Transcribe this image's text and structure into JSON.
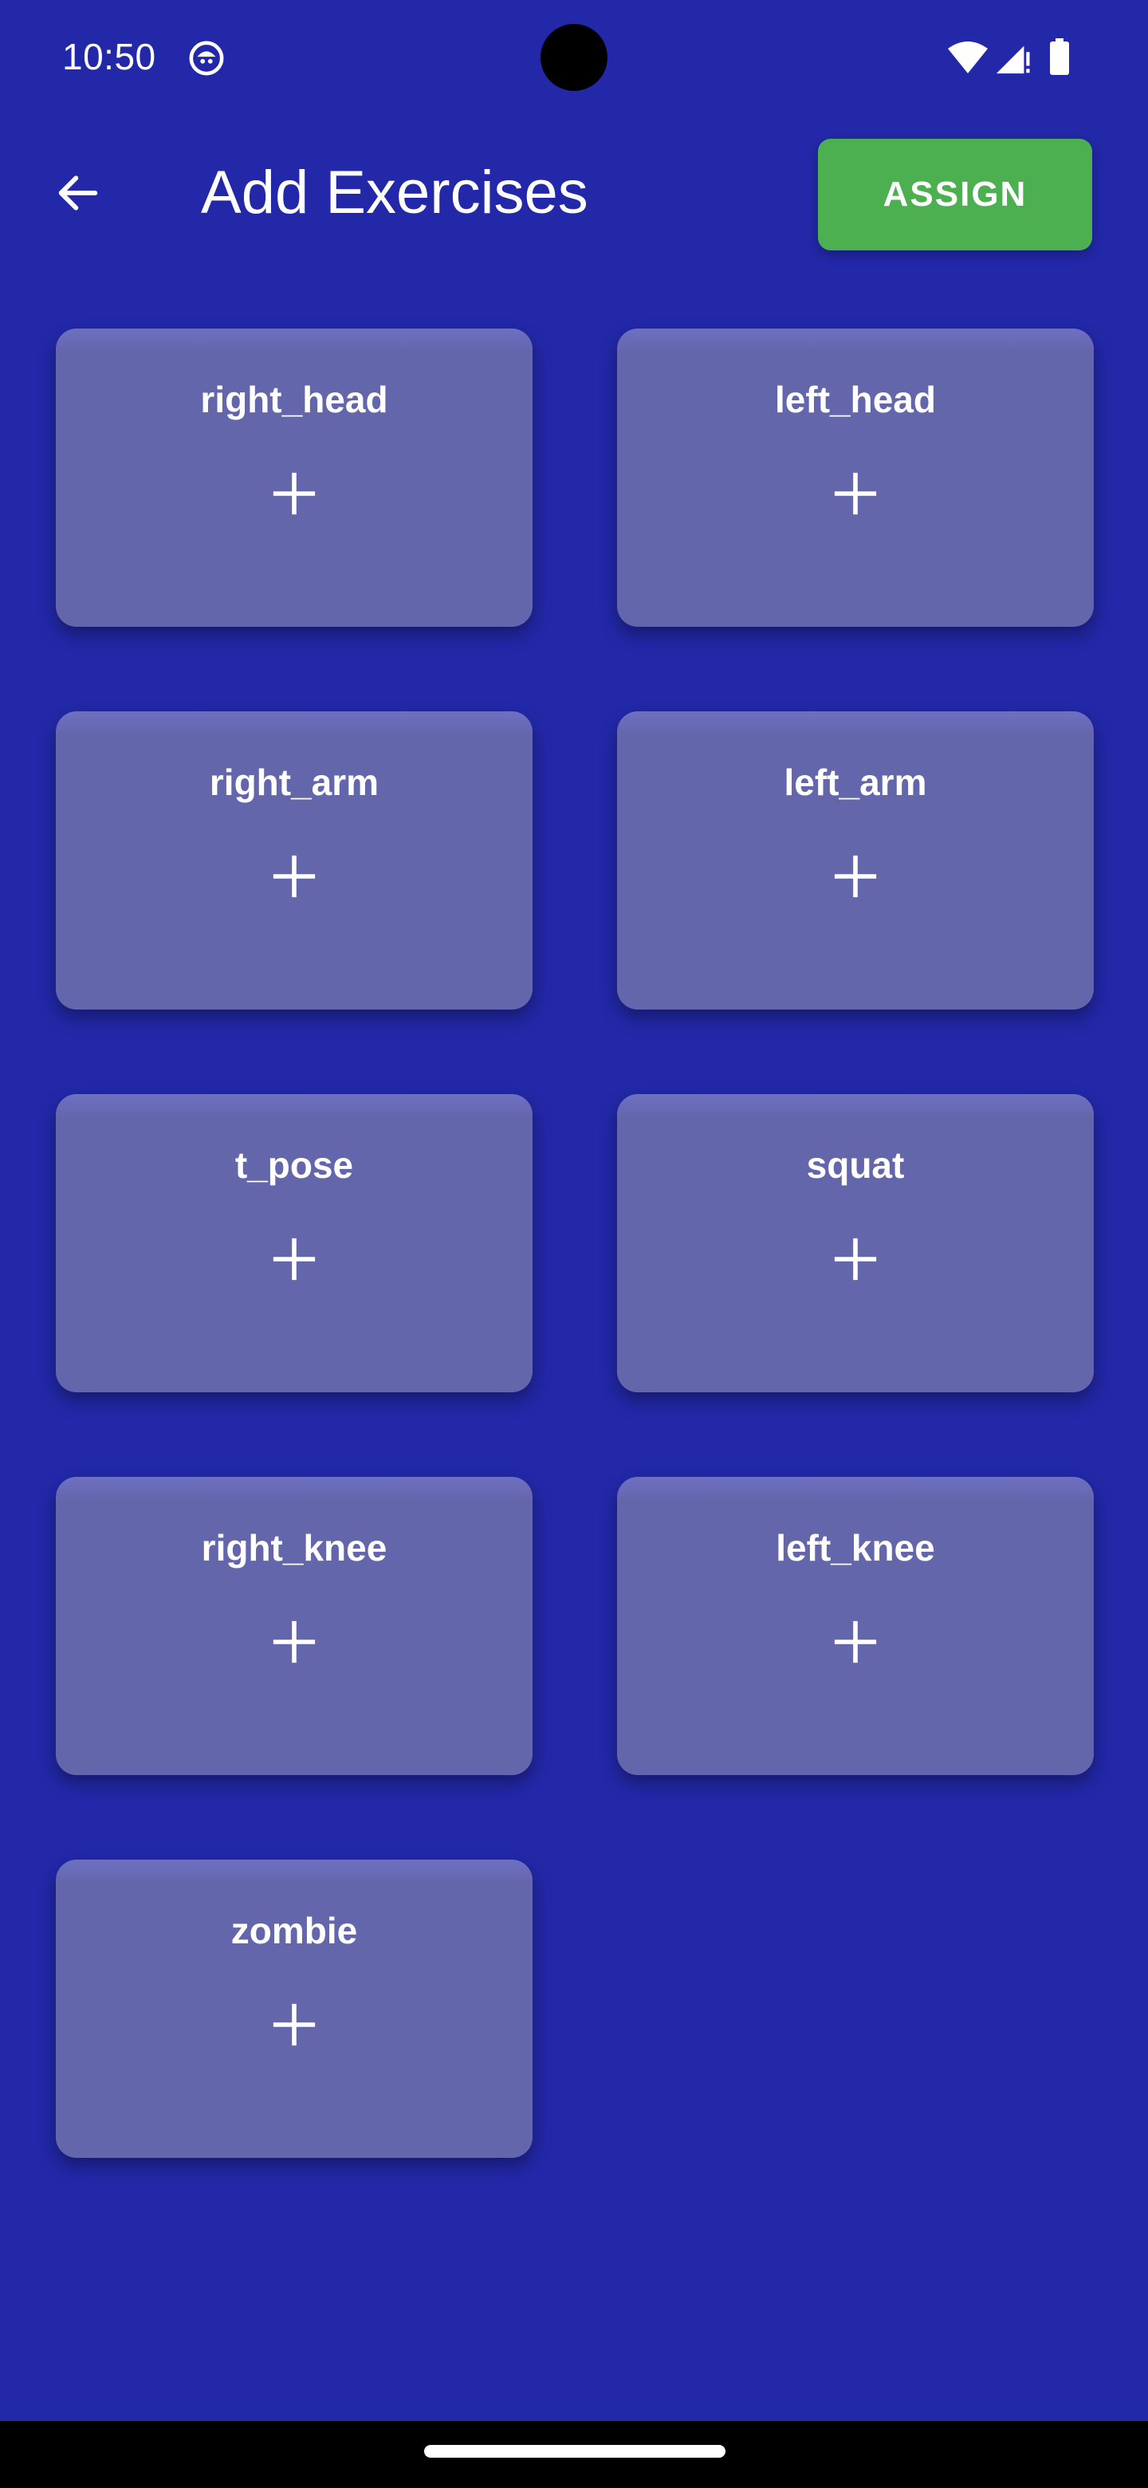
{
  "status_bar": {
    "time": "10:50",
    "icons": [
      "app-notification-icon",
      "wifi-icon",
      "cellular-signal-icon",
      "battery-icon"
    ]
  },
  "app_bar": {
    "back_icon": "arrow-back-icon",
    "title": "Add Exercises",
    "assign_label": "ASSIGN"
  },
  "colors": {
    "background": "#2228a8",
    "card": "#6466ab",
    "assign_button": "#4caf50",
    "text": "#ffffff"
  },
  "exercises": [
    {
      "label": "right_head",
      "icon": "plus-icon"
    },
    {
      "label": "left_head",
      "icon": "plus-icon"
    },
    {
      "label": "right_arm",
      "icon": "plus-icon"
    },
    {
      "label": "left_arm",
      "icon": "plus-icon"
    },
    {
      "label": "t_pose",
      "icon": "plus-icon"
    },
    {
      "label": "squat",
      "icon": "plus-icon"
    },
    {
      "label": "right_knee",
      "icon": "plus-icon"
    },
    {
      "label": "left_knee",
      "icon": "plus-icon"
    },
    {
      "label": "zombie",
      "icon": "plus-icon"
    }
  ]
}
